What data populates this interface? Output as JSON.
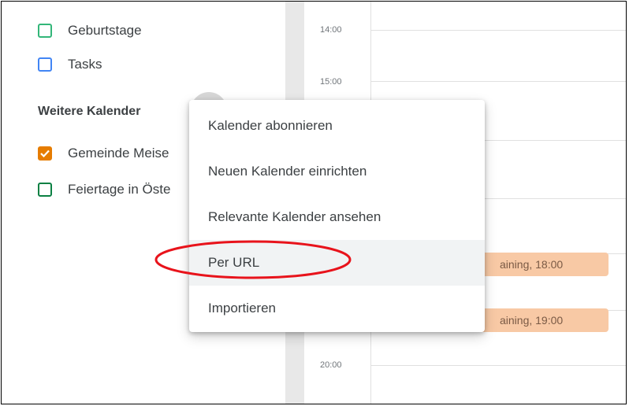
{
  "sidebar": {
    "my_calendars": [
      {
        "label": "Geburtstage",
        "color": "#33b679",
        "checked": false
      },
      {
        "label": "Tasks",
        "color": "#4285f4",
        "checked": false
      }
    ],
    "other_title": "Weitere Kalender",
    "other_calendars": [
      {
        "label": "Gemeinde Meise",
        "color": "#e67c00",
        "checked": true
      },
      {
        "label": "Feiertage in Öste",
        "color": "#0b8043",
        "checked": false
      }
    ]
  },
  "grid": {
    "times": [
      "14:00",
      "15:00",
      "20:00"
    ],
    "events": [
      {
        "label": "aining, 18:00"
      },
      {
        "label": "aining, 19:00"
      }
    ]
  },
  "menu": {
    "items": [
      "Kalender abonnieren",
      "Neuen Kalender einrichten",
      "Relevante Kalender ansehen",
      "Per URL",
      "Importieren"
    ],
    "highlighted_index": 3
  },
  "annotation": {
    "color": "#e8131b",
    "shape": "ellipse"
  }
}
